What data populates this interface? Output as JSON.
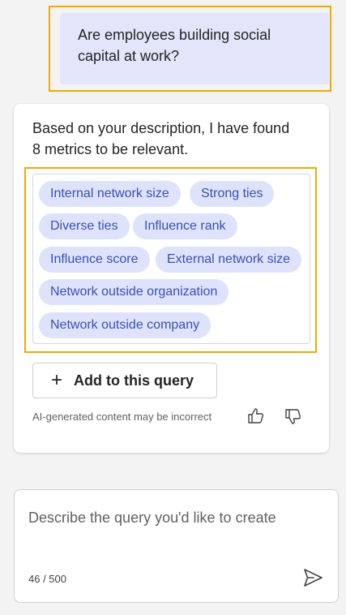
{
  "user_message": {
    "text": "Are employees building social capital at work?"
  },
  "response": {
    "text": "Based on your description, I have found 8 metrics to be relevant.",
    "metrics": [
      "Internal network size",
      "Strong ties",
      "Diverse ties",
      "Influence rank",
      "Influence score",
      "External network size",
      "Network outside organization",
      "Network outside company"
    ],
    "add_button_label": "Add to this query",
    "add_button_icon": "plus-icon",
    "disclaimer": "AI-generated content may be incorrect",
    "thumbs_up_icon": "thumbs-up-icon",
    "thumbs_down_icon": "thumbs-down-icon"
  },
  "composer": {
    "placeholder": "Describe the query you'd like to create",
    "char_count": "46 / 500",
    "send_icon": "send-icon"
  },
  "colors": {
    "highlight": "#f2a900",
    "chip_bg": "#dee3fb",
    "chip_text": "#3a4fb5",
    "user_bubble_bg": "#e3e6fb",
    "page_bg": "#f3f3f3"
  }
}
